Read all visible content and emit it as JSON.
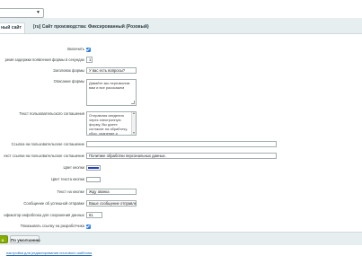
{
  "tabs": [
    {
      "label": "ный сайт"
    },
    {
      "label": "[ru] Сайт производства: Фиксированный (Розовый)"
    }
  ],
  "form": {
    "enable": {
      "label": "Включить",
      "checked": true
    },
    "delay": {
      "label": "ремя задержки появления формы в секундах",
      "value": "1"
    },
    "form_title": {
      "label": "Заголовок формы",
      "value": "У вас есть вопросы?"
    },
    "form_desc": {
      "label": "Описание формы",
      "value": "Давайте мы перезвоним вам и все расскажем"
    },
    "agreement_text": {
      "label": "Текст пользовательского соглашения",
      "value": "Отправляя сведения через электронную форму, Вы даете согласие на обработку, сбор, хранение и"
    },
    "agreement_link": {
      "label": "Ссылка на пользовательское соглашение",
      "value": ""
    },
    "agreement_link_text": {
      "label": "екст ссылки на пользовательское соглашение",
      "value": "Политикe обработки персональных данных."
    },
    "button_color": {
      "label": "Цвет кнопки",
      "color": "#2540b8"
    },
    "button_text_color": {
      "label": "Цвет текста кнопки",
      "color": "#ffffff"
    },
    "button_text": {
      "label": "Текст на кнопке",
      "value": "Жду звонка"
    },
    "success_message": {
      "label": "Сообщение об успешной отправке",
      "value": "Ваше сообщение отправлено!"
    },
    "iblock_id": {
      "label": "ификатор инфоблока для сохранения данных",
      "value": "61"
    },
    "show_dev_link": {
      "label": "Показывать ссылку на разработчика",
      "checked": true
    }
  },
  "footer": {
    "save_label": "о",
    "default_label": "По умолчанию",
    "link_text": "настройки для редактирования почтового шаблона"
  }
}
